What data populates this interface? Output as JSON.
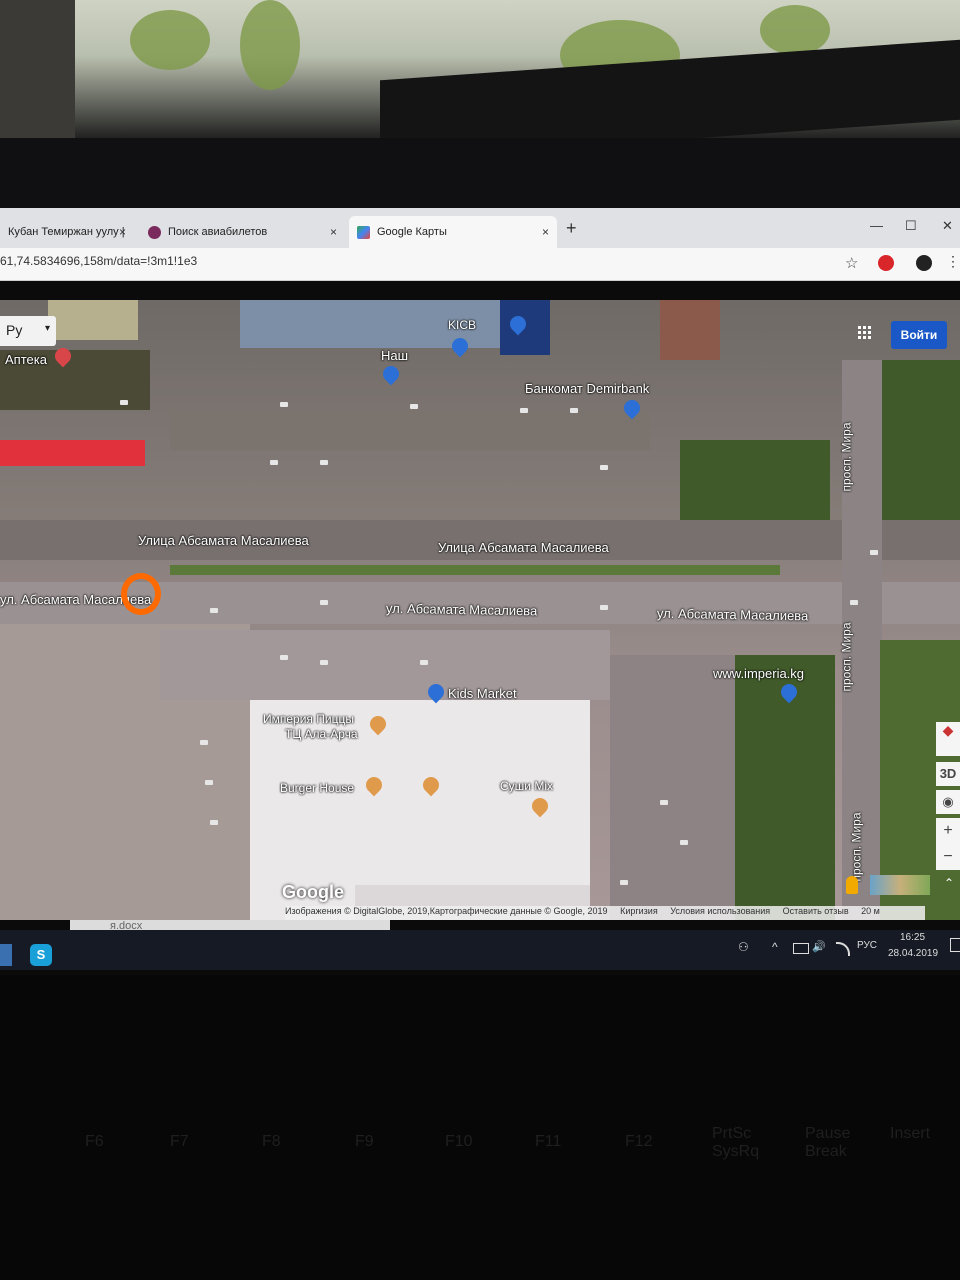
{
  "browser": {
    "tabs": [
      {
        "label": "Кубан Темиржан уулу |",
        "close": "×"
      },
      {
        "label": "Поиск авиабилетов",
        "close": "×"
      },
      {
        "label": "Google Карты",
        "close": "×"
      }
    ],
    "new_tab": "+",
    "window_controls": {
      "minimize": "—",
      "maximize": "☐",
      "close": "✕"
    },
    "url": "61,74.5834696,158m/data=!3m1!1e3",
    "star": "☆",
    "menu": "⋮"
  },
  "map": {
    "language_select": "Ру",
    "caret": "▾",
    "signin_button": "Войти",
    "labels": {
      "apteka": "Аптека",
      "kicb": "KICB",
      "nash": "Наш",
      "bankomat": "Банкомат Demirbank",
      "street_top_1": "Улица Абсамата Масалиева",
      "street_top_2": "Улица Абсамата Масалиева",
      "street_bottom_left": "ул. Абсамата Масалиева",
      "street_bottom_mid": "ул. Абсамата Масалиева",
      "street_bottom_right": "ул. Абсамата Масалиева",
      "prosp_mira_1": "просп. Мира",
      "prosp_mira_2": "просп. Мира",
      "prosp_mira_3": "просп. Мира",
      "imperia": "www.imperia.kg",
      "kids_market": "Kids Market",
      "imperia_pizza": "Империя Пиццы",
      "tc_ala_archa": "ТЦ Ала-Арча",
      "burger_house": "Burger House",
      "sushi_mix": "Суши Mix"
    },
    "google_logo": "Google",
    "controls": {
      "compass": "◆",
      "three_d": "3D",
      "locate": "◉",
      "zoom_in": "+",
      "zoom_out": "−",
      "expand": "⌃"
    },
    "attribution": {
      "imagery": "Изображения © DigitalGlobe, 2019,Картографические данные © Google, 2019",
      "country": "Киргизия",
      "terms": "Условия использования",
      "feedback": "Оставить отзыв",
      "scale": "20 м"
    }
  },
  "taskbar": {
    "doc_name": "я.docx",
    "skype": "S",
    "tray_people": "⚇",
    "tray_chevron": "^",
    "tray_volume": "🔊",
    "tray_lang": "РУС",
    "time": "16:25",
    "date": "28.04.2019"
  },
  "keyboard_keys": [
    "F6",
    "F7",
    "F8",
    "F9",
    "F10",
    "F11",
    "F12",
    "PrtSc SysRq",
    "Pause Break",
    "Insert"
  ]
}
